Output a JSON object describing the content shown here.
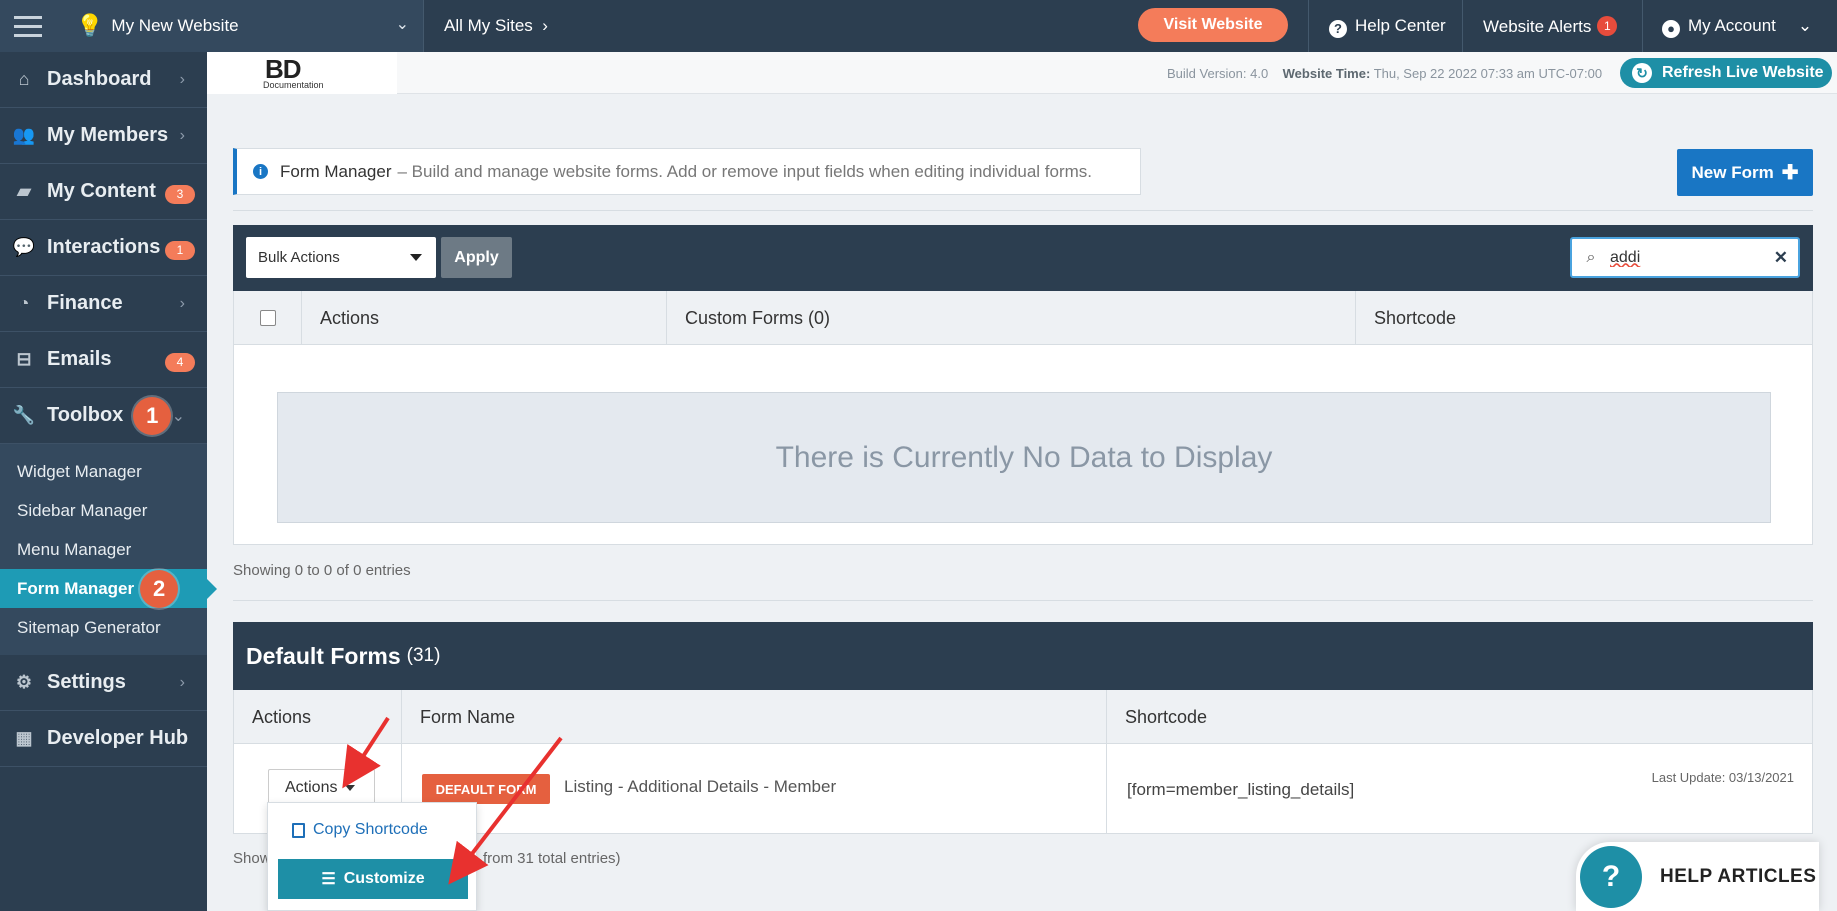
{
  "topbar": {
    "site_name": "My New Website",
    "all_sites": "All My Sites",
    "visit_website": "Visit Website",
    "help_center": "Help Center",
    "website_alerts": "Website Alerts",
    "alerts_count": "1",
    "my_account": "My Account"
  },
  "sidebar": {
    "items": [
      {
        "label": "Dashboard",
        "icon": "home-icon"
      },
      {
        "label": "My Members",
        "icon": "users-icon"
      },
      {
        "label": "My Content",
        "icon": "folder-icon",
        "badge": "3"
      },
      {
        "label": "Interactions",
        "icon": "comments-icon",
        "badge": "1"
      },
      {
        "label": "Finance",
        "icon": "pie-chart-icon"
      },
      {
        "label": "Emails",
        "icon": "inbox-icon",
        "badge": "4"
      },
      {
        "label": "Toolbox",
        "icon": "wrench-icon",
        "step": "1"
      },
      {
        "label": "Settings",
        "icon": "gear-icon"
      },
      {
        "label": "Developer Hub",
        "icon": "grid-icon"
      }
    ],
    "toolbox_items": [
      {
        "label": "Widget Manager"
      },
      {
        "label": "Sidebar Manager"
      },
      {
        "label": "Menu Manager"
      },
      {
        "label": "Form Manager",
        "step": "2"
      },
      {
        "label": "Sitemap Generator"
      }
    ]
  },
  "subheader": {
    "logo_main": "BD",
    "logo_sub": "Documentation",
    "build_version": "Build Version: 4.0",
    "website_time_label": "Website Time:",
    "website_time_value": "Thu, Sep 22 2022 07:33 am UTC-07:00",
    "refresh_button": "Refresh Live Website"
  },
  "info": {
    "title": "Form Manager",
    "description": "– Build and manage website forms. Add or remove input fields when editing individual forms."
  },
  "new_form_button": "New Form",
  "custom_forms": {
    "bulk_actions": "Bulk Actions",
    "apply": "Apply",
    "search_value": "addi",
    "columns": {
      "actions": "Actions",
      "custom_forms": "Custom Forms (0)",
      "shortcode": "Shortcode"
    },
    "no_data": "There is Currently No Data to Display",
    "showing": "Showing 0 to 0 of 0 entries"
  },
  "default_forms": {
    "title": "Default Forms",
    "count": "(31)",
    "columns": {
      "actions": "Actions",
      "form_name": "Form Name",
      "shortcode": "Shortcode"
    },
    "rows": [
      {
        "actions_label": "Actions",
        "tag": "DEFAULT FORM",
        "name": "Listing - Additional Details - Member",
        "shortcode": "[form=member_listing_details]",
        "last_update": "Last Update: 03/13/2021"
      }
    ],
    "showing_prefix": "Show",
    "showing_suffix": "from 31 total entries)"
  },
  "dropdown": {
    "copy_shortcode": "Copy Shortcode",
    "customize": "Customize"
  },
  "help_articles": "HELP ARTICLES",
  "colors": {
    "nav_bg": "#2c3e50",
    "accent_teal": "#1e8fa6",
    "accent_blue": "#1976c4",
    "accent_orange": "#f47c5a",
    "annotation_red": "#e8312f"
  }
}
